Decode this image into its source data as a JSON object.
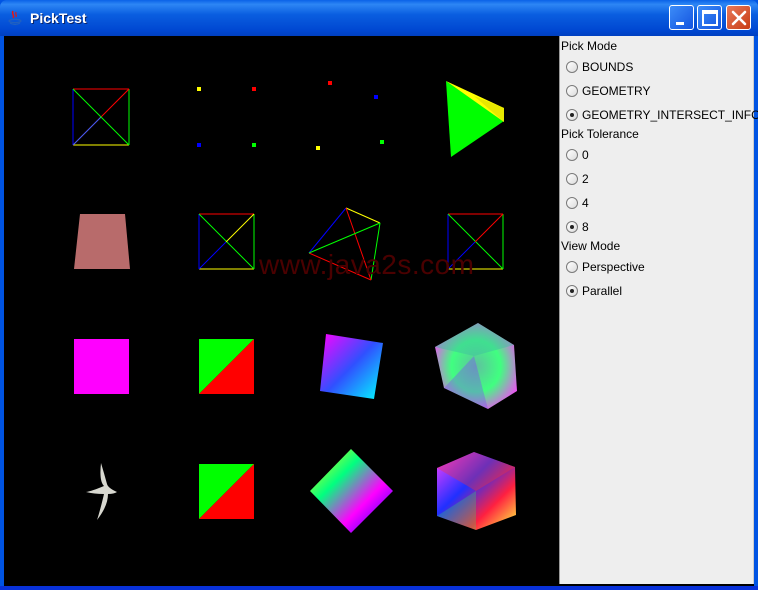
{
  "window": {
    "title": "PickTest",
    "watermark": "www.java2s.com"
  },
  "panel": {
    "groups": [
      {
        "header": "Pick Mode",
        "options": [
          {
            "label": "BOUNDS",
            "selected": false
          },
          {
            "label": "GEOMETRY",
            "selected": false
          },
          {
            "label": "GEOMETRY_INTERSECT_INFO",
            "selected": true
          }
        ]
      },
      {
        "header": "Pick Tolerance",
        "options": [
          {
            "label": "0",
            "selected": false
          },
          {
            "label": "2",
            "selected": false
          },
          {
            "label": "4",
            "selected": false
          },
          {
            "label": "8",
            "selected": true
          }
        ]
      },
      {
        "header": "View Mode",
        "options": [
          {
            "label": "Perspective",
            "selected": false
          },
          {
            "label": "Parallel",
            "selected": true
          }
        ]
      }
    ]
  },
  "colors": {
    "titlebar": "#0054e3",
    "canvas_bg": "#000000",
    "panel_bg": "#eeeeee",
    "magenta": "#ff00ff",
    "green": "#00ff00",
    "red": "#ff0000",
    "trapezoid": "#b86b6b"
  }
}
